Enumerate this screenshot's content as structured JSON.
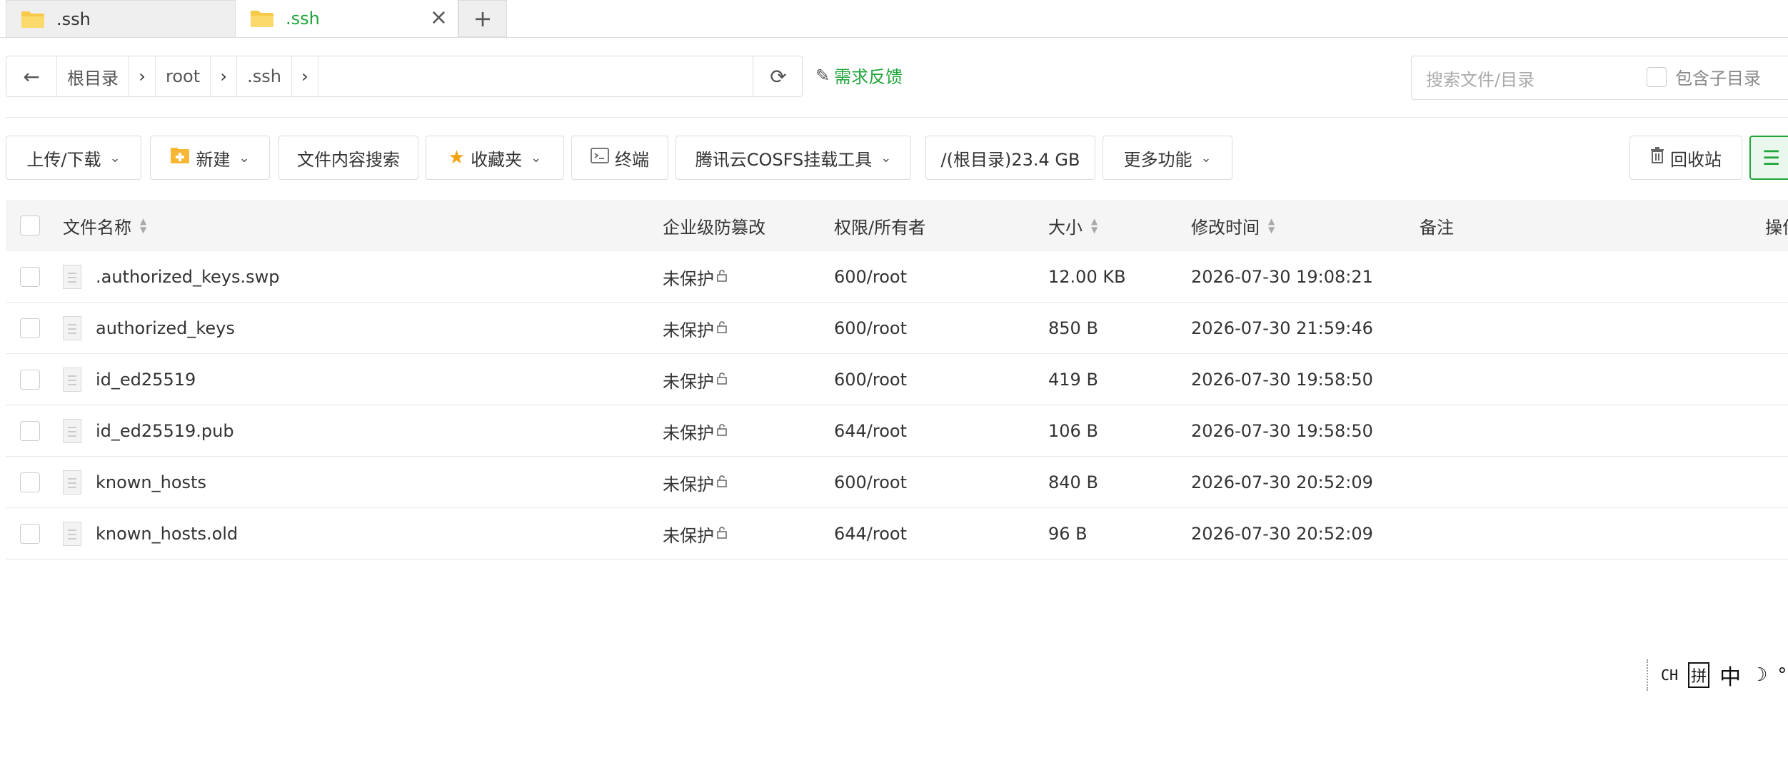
{
  "tabs": [
    {
      "label": ".ssh",
      "active": false
    },
    {
      "label": ".ssh",
      "active": true
    }
  ],
  "new_tab": "+",
  "tab_close": "×",
  "pathbar": {
    "back": "←",
    "crumbs": [
      "根目录",
      "root",
      ".ssh"
    ],
    "separator": "›",
    "refresh": "⟳"
  },
  "feedback": {
    "label": "需求反馈"
  },
  "search": {
    "placeholder": "搜索文件/目录",
    "subdir_label": "包含子目录"
  },
  "toolbar": {
    "upload": "上传/下载",
    "new": "新建",
    "content_search": "文件内容搜索",
    "favorites": "收藏夹",
    "terminal": "终端",
    "cosfs": "腾讯云COSFS挂载工具",
    "disk": "/(根目录)23.4 GB",
    "more": "更多功能",
    "recycle": "回收站",
    "caret": "⌄",
    "list_view_icon": "☰"
  },
  "table": {
    "headers": {
      "name": "文件名称",
      "protect": "企业级防篡改",
      "perm": "权限/所有者",
      "size": "大小",
      "mtime": "修改时间",
      "note": "备注",
      "ops": "操作"
    },
    "rows": [
      {
        "name": ".authorized_keys.swp",
        "protect": "未保护",
        "perm": "600/root",
        "size": "12.00 KB",
        "mtime": "2026-07-30 19:08:21"
      },
      {
        "name": "authorized_keys",
        "protect": "未保护",
        "perm": "600/root",
        "size": "850 B",
        "mtime": "2026-07-30 21:59:46"
      },
      {
        "name": "id_ed25519",
        "protect": "未保护",
        "perm": "600/root",
        "size": "419 B",
        "mtime": "2026-07-30 19:58:50"
      },
      {
        "name": "id_ed25519.pub",
        "protect": "未保护",
        "perm": "644/root",
        "size": "106 B",
        "mtime": "2026-07-30 19:58:50"
      },
      {
        "name": "known_hosts",
        "protect": "未保护",
        "perm": "600/root",
        "size": "840 B",
        "mtime": "2026-07-30 20:52:09"
      },
      {
        "name": "known_hosts.old",
        "protect": "未保护",
        "perm": "644/root",
        "size": "96 B",
        "mtime": "2026-07-30 20:52:09"
      }
    ]
  },
  "ime": {
    "items": [
      "CH",
      "拼",
      "中",
      "☽",
      "°"
    ]
  },
  "colors": {
    "accent": "#20a53a",
    "border": "#dcdcdc",
    "header_bg": "#f5f5f5"
  }
}
